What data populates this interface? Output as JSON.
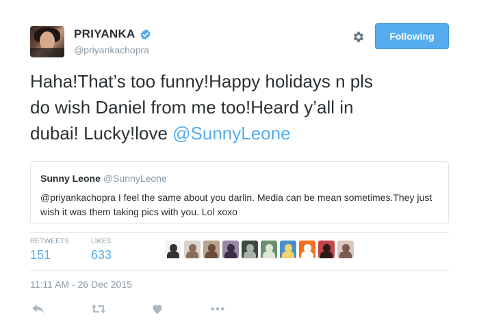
{
  "author": {
    "display_name": "PRIYANKA",
    "handle": "@priyankachopra"
  },
  "follow_button": {
    "label": "Following"
  },
  "tweet": {
    "text_parts": [
      "Haha!That’s too funny!Happy holidays n pls\ndo wish Daniel from me too!Heard y’all in\ndubai! Lucky!love "
    ],
    "mention": "@SunnyLeone"
  },
  "quote": {
    "name": "Sunny Leone",
    "handle": "@SunnyLeone",
    "text": "@priyankachopra I feel the same about you darlin. Media can be mean sometimes.They just wish it was them taking pics with you. Lol xoxo"
  },
  "stats": {
    "retweets_label": "RETWEETS",
    "retweets_value": "151",
    "likes_label": "LIKES",
    "likes_value": "633"
  },
  "likers": [
    {
      "icon": "logo-avatar",
      "bg": "#f4f4f4",
      "fg": "#333333"
    },
    {
      "icon": "person-avatar",
      "bg": "#d9d4cf",
      "fg": "#8a6d5a"
    },
    {
      "icon": "person-avatar",
      "bg": "#b7a48f",
      "fg": "#6a4e3a"
    },
    {
      "icon": "person-avatar",
      "bg": "#9a86a6",
      "fg": "#3b2d45"
    },
    {
      "icon": "person-avatar",
      "bg": "#3d4a40",
      "fg": "#a8b3a6"
    },
    {
      "icon": "person-avatar",
      "bg": "#6a8e6e",
      "fg": "#dfe6d9"
    },
    {
      "icon": "comic-avatar",
      "bg": "#4a8fc7",
      "fg": "#f2d36b"
    },
    {
      "icon": "orange-logo-avatar",
      "bg": "#f36f21",
      "fg": "#ffffff"
    },
    {
      "icon": "person-avatar",
      "bg": "#c2464a",
      "fg": "#2b1a1a"
    },
    {
      "icon": "person-avatar",
      "bg": "#d8c8c0",
      "fg": "#7a5a50"
    }
  ],
  "timestamp": "11:11 AM - 26 Dec 2015",
  "colors": {
    "accent": "#55acee",
    "muted": "#8899a6",
    "text": "#292f33",
    "border": "#e1e8ed"
  }
}
